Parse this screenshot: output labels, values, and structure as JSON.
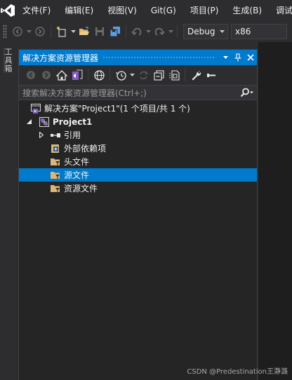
{
  "colors": {
    "accent": "#007acc",
    "background": "#2d2d30",
    "panel": "#252526",
    "vs_purple": "#865fc5"
  },
  "menubar": {
    "logo": "visual-studio-logo-icon",
    "items": [
      {
        "label": "文件(F)"
      },
      {
        "label": "编辑(E)"
      },
      {
        "label": "视图(V)"
      },
      {
        "label": "Git(G)"
      },
      {
        "label": "项目(P)"
      },
      {
        "label": "生成(B)"
      },
      {
        "label": "调试("
      }
    ]
  },
  "toolbar": {
    "configuration": "Debug",
    "platform": "x86",
    "icons": [
      "back-icon",
      "forward-icon",
      "new-project-icon",
      "open-folder-icon",
      "save-icon",
      "save-all-icon",
      "undo-icon",
      "redo-icon"
    ]
  },
  "toolbox": {
    "label": "工具箱"
  },
  "solution_explorer": {
    "title": "解决方案资源管理器",
    "search_placeholder": "搜索解决方案资源管理器(Ctrl+;)",
    "toolbar_icons": [
      "back-icon",
      "forward-icon",
      "home-icon",
      "vs-switch-view-icon",
      "globe-icon",
      "history-icon",
      "sync-icon",
      "collapse-all-icon",
      "show-all-files-icon",
      "properties-wrench-icon",
      "pin-preview-icon"
    ],
    "tree": [
      {
        "label": "解决方案\"Project1\"(1 个项目/共 1 个)",
        "icon": "solution-icon",
        "level": 0,
        "expander": ""
      },
      {
        "label": "Project1",
        "icon": "cpp-project-icon",
        "level": 1,
        "expander": "expanded",
        "bold": true
      },
      {
        "label": "引用",
        "icon": "references-icon",
        "level": 2,
        "expander": "collapsed"
      },
      {
        "label": "外部依赖项",
        "icon": "external-dependencies-icon",
        "level": 2,
        "expander": ""
      },
      {
        "label": "头文件",
        "icon": "filter-folder-icon",
        "level": 2,
        "expander": ""
      },
      {
        "label": "源文件",
        "icon": "filter-folder-icon",
        "level": 2,
        "expander": "",
        "selected": true
      },
      {
        "label": "资源文件",
        "icon": "filter-folder-icon",
        "level": 2,
        "expander": ""
      }
    ]
  },
  "watermark": "CSDN @Predestination王瀞潞"
}
